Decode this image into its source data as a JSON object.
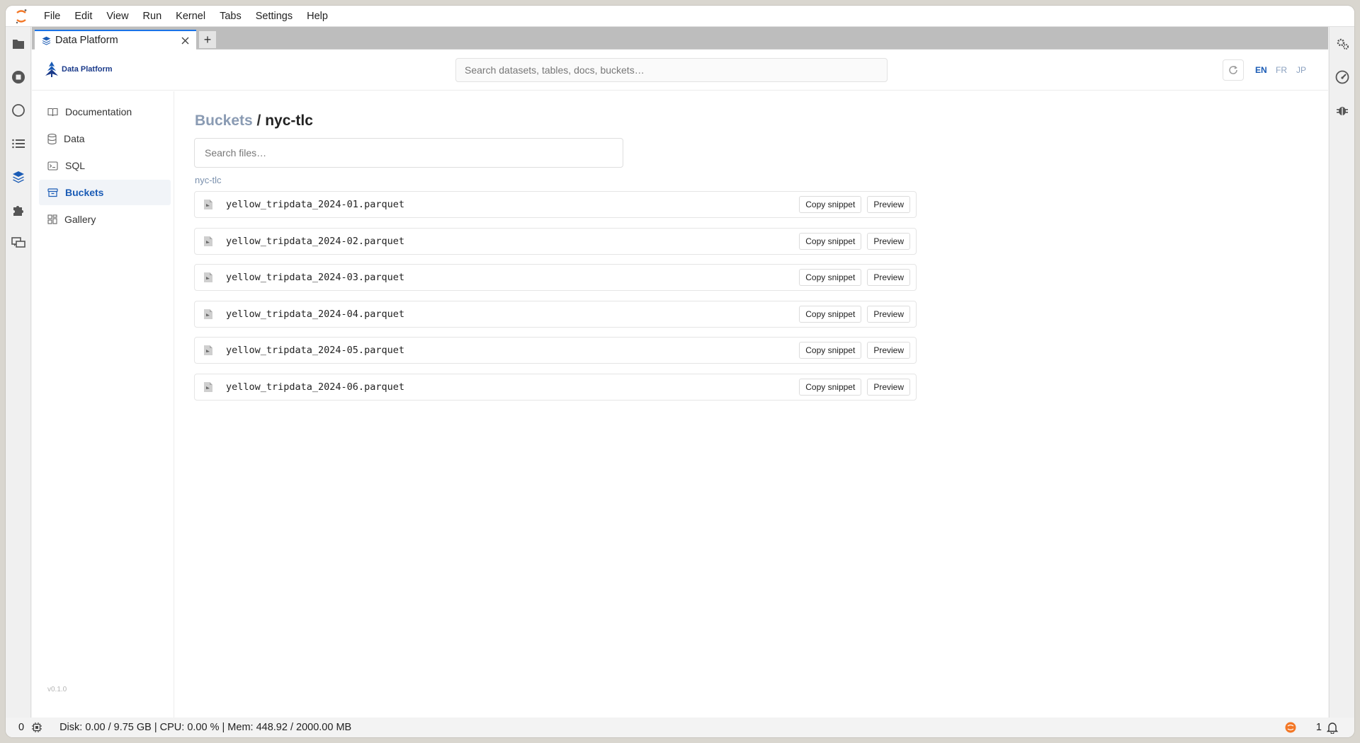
{
  "menubar": {
    "items": [
      "File",
      "Edit",
      "View",
      "Run",
      "Kernel",
      "Tabs",
      "Settings",
      "Help"
    ]
  },
  "tab": {
    "title": "Data Platform",
    "add_label": "+"
  },
  "header": {
    "brand": "Data Platform",
    "search_placeholder": "Search datasets, tables, docs, buckets…",
    "languages": [
      "EN",
      "FR",
      "JP"
    ],
    "active_language": "EN"
  },
  "sidebar": {
    "items": [
      {
        "label": "Documentation",
        "icon": "book-icon"
      },
      {
        "label": "Data",
        "icon": "database-icon"
      },
      {
        "label": "SQL",
        "icon": "terminal-icon"
      },
      {
        "label": "Buckets",
        "icon": "bucket-icon",
        "active": true
      },
      {
        "label": "Gallery",
        "icon": "gallery-icon"
      }
    ],
    "version": "v0.1.0"
  },
  "content": {
    "breadcrumb": {
      "root": "Buckets",
      "separator": " / ",
      "current": "nyc-tlc"
    },
    "search_placeholder": "Search files…",
    "section_label": "nyc-tlc",
    "files": [
      "yellow_tripdata_2024-01.parquet",
      "yellow_tripdata_2024-02.parquet",
      "yellow_tripdata_2024-03.parquet",
      "yellow_tripdata_2024-04.parquet",
      "yellow_tripdata_2024-05.parquet",
      "yellow_tripdata_2024-06.parquet"
    ],
    "copy_label": "Copy snippet",
    "preview_label": "Preview"
  },
  "statusbar": {
    "count": "0",
    "resources": "Disk: 0.00 / 9.75 GB | CPU: 0.00 % | Mem: 448.92 / 2000.00 MB",
    "notifications": "1"
  },
  "colors": {
    "accent": "#1a5bb5",
    "breadcrumb_link": "#8a9bb3",
    "jupyter_orange": "#f37726"
  }
}
